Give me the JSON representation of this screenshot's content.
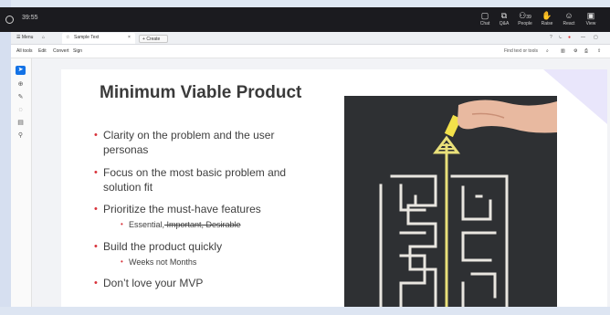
{
  "meeting": {
    "timer": "39:55",
    "buttons": [
      {
        "label": "Chat",
        "icon": "chat-icon",
        "glyph": "💬"
      },
      {
        "label": "Q&A",
        "icon": "qa-icon",
        "glyph": "?"
      },
      {
        "label": "People",
        "icon": "people-icon",
        "glyph": "👥",
        "badge": "39"
      },
      {
        "label": "Raise",
        "icon": "raise-hand-icon",
        "glyph": "✋"
      },
      {
        "label": "React",
        "icon": "react-icon",
        "glyph": "☺"
      },
      {
        "label": "View",
        "icon": "view-icon",
        "glyph": "▣"
      }
    ]
  },
  "app": {
    "menu_label": "Menu",
    "tab_title": "Sample Text",
    "new_tab_label": "Create",
    "menubar": [
      "All tools",
      "Edit",
      "Convert",
      "Sign"
    ],
    "find_label": "Find text or tools"
  },
  "slide": {
    "title": "Minimum Viable Product",
    "bullets": [
      {
        "line1": "Clarity on the problem and the user",
        "line2": "personas"
      },
      {
        "line1": "Focus on the most basic problem and",
        "line2": "solution fit"
      },
      {
        "line1": "Prioritize the must-have features",
        "line2": ""
      },
      {
        "line1": "Build the product quickly",
        "line2": ""
      },
      {
        "line1": "Don’t love your MVP",
        "line2": ""
      }
    ],
    "sub_features": {
      "kept": "Essential,",
      "struck": " Important, Desirable"
    },
    "sub_weeks": "Weeks not Months"
  },
  "colors": {
    "bullet": "#d8323a",
    "accent": "#1473e6",
    "meeting_bar": "#1b1b1f"
  }
}
